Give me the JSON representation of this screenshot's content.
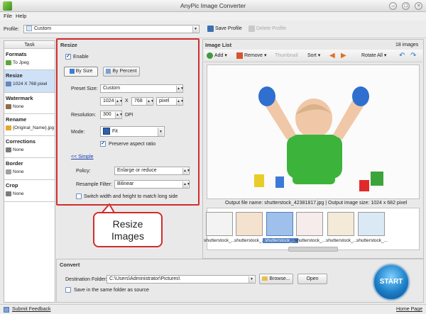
{
  "window": {
    "title": "AnyPic Image Converter",
    "minimize": "–",
    "maximize": "□",
    "close": "×"
  },
  "menu": [
    {
      "label": "File"
    },
    {
      "label": "Help"
    }
  ],
  "profile": {
    "label": "Profile:",
    "value": "Custom",
    "save_label": "Save Profile",
    "delete_label": "Delete Profile"
  },
  "task": {
    "header": "Task",
    "sections": [
      {
        "title": "Formats",
        "value": "To Jpeg"
      },
      {
        "title": "Resize",
        "value": "1024 X 768 pixel"
      },
      {
        "title": "Watermark",
        "value": "None"
      },
      {
        "title": "Rename",
        "value": "{Original_Name}.jpg"
      },
      {
        "title": "Corrections",
        "value": "None"
      },
      {
        "title": "Border",
        "value": "None"
      },
      {
        "title": "Crop",
        "value": "None"
      }
    ]
  },
  "resize": {
    "title": "Resize",
    "enable_label": "Enable",
    "by_size": "By Size",
    "by_percent": "By Percent",
    "preset_label": "Preset Size:",
    "preset_value": "Custom",
    "width": "1024",
    "x": "X",
    "height": "768",
    "unit": "pixel",
    "resolution_label": "Resolution:",
    "resolution_value": "300",
    "dpi": "DPI",
    "mode_label": "Mode:",
    "mode_value": "Fit",
    "preserve_label": "Preserve aspect ratio",
    "simple_link": "<< Simple",
    "policy_label": "Policy:",
    "policy_value": "Enlarge or reduce",
    "filter_label": "Resample Filter:",
    "filter_value": "Bilinear",
    "switch_label": "Switch width and height to match long side"
  },
  "callout": {
    "line1": "Resize",
    "line2": "Images"
  },
  "image_list": {
    "title": "Image List",
    "count": "18 images",
    "add": "Add",
    "remove": "Remove",
    "thumbnail": "Thumbnail",
    "sort": "Sort",
    "rotate_all": "Rotate All",
    "output_info": "Output file name: shutterstock_42381817.jpg | Output image size: 1024 x 682 pixel",
    "thumbnails": [
      {
        "label": "shutterstock_..."
      },
      {
        "label": "shutterstock_..."
      },
      {
        "label": "shutterstock_..."
      },
      {
        "label": "shutterstock_..."
      },
      {
        "label": "shutterstock_..."
      },
      {
        "label": "shutterstock_..."
      }
    ]
  },
  "convert": {
    "title": "Convert",
    "dest_label": "Destination Folder:",
    "dest_value": "C:\\Users\\Administrator\\Pictures\\",
    "browse": "Browse...",
    "open": "Open",
    "same_folder_label": "Save in the same folder as source",
    "start": "START"
  },
  "status": {
    "feedback": "Submit Feedback",
    "home": "Home Page"
  },
  "colors": {
    "accent_red": "#d12c2c",
    "selected_blue": "#cfe1f7",
    "start_blue": "#1c7fc8"
  }
}
